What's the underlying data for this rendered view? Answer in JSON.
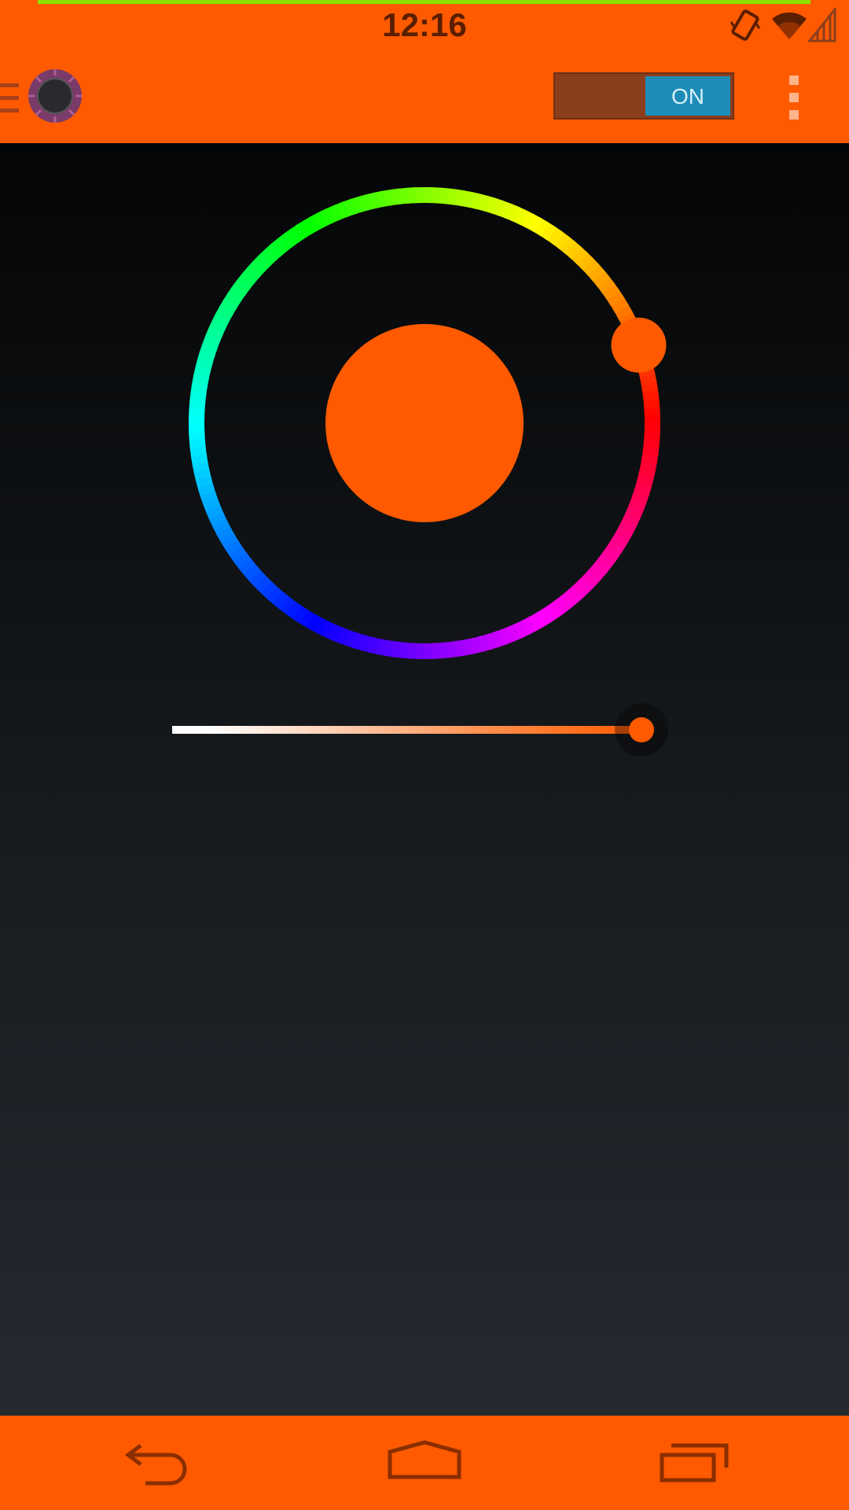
{
  "status_bar": {
    "time": "12:16",
    "icons": [
      "vibrate-icon",
      "wifi-icon",
      "cell-signal-icon"
    ]
  },
  "action_bar": {
    "icons": [
      "menu-icon",
      "app-logo-icon",
      "overflow-menu-icon"
    ],
    "power_toggle": {
      "label": "ON",
      "state": "on"
    }
  },
  "color_picker": {
    "selected_color": "#ff5a00",
    "selected_hue_degrees": 20,
    "brightness_fraction": 1.0
  },
  "nav_bar": {
    "icons": [
      "back-icon",
      "home-icon",
      "recent-apps-icon"
    ]
  },
  "theme": {
    "accent": "#ff5a00",
    "toggle_on": "#1e8cb8"
  }
}
